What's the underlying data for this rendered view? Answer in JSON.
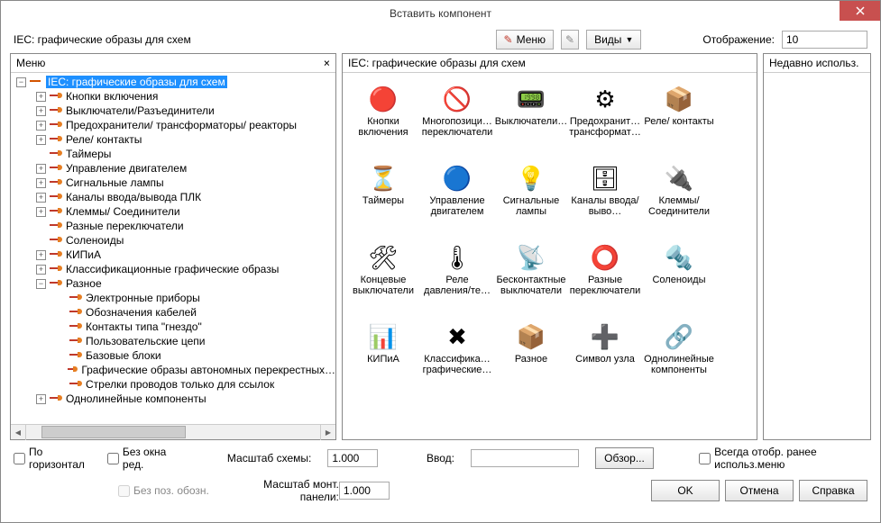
{
  "title": "Вставить компонент",
  "toprow": {
    "schema_label": "IEC: графические образы для схем",
    "menu_btn": "Меню",
    "views_btn": "Виды",
    "display_label": "Отображение:",
    "display_value": "10"
  },
  "panels": {
    "left_header": "Меню",
    "center_header": "IEC: графические образы для схем",
    "right_header": "Недавно использ."
  },
  "tree": {
    "root": "IEC: графические образы для схем",
    "level1": [
      {
        "label": "Кнопки включения",
        "exp": "+"
      },
      {
        "label": "Выключатели/Разъединители",
        "exp": "+"
      },
      {
        "label": "Предохранители/ трансформаторы/ реакторы",
        "exp": "+"
      },
      {
        "label": "Реле/ контакты",
        "exp": "+"
      },
      {
        "label": "Таймеры",
        "exp": ""
      },
      {
        "label": "Управление двигателем",
        "exp": "+"
      },
      {
        "label": "Сигнальные лампы",
        "exp": "+"
      },
      {
        "label": "Каналы ввода/вывода ПЛК",
        "exp": "+"
      },
      {
        "label": "Клеммы/ Соединители",
        "exp": "+"
      },
      {
        "label": "Разные переключатели",
        "exp": ""
      },
      {
        "label": "Соленоиды",
        "exp": ""
      },
      {
        "label": "КИПиА",
        "exp": "+"
      },
      {
        "label": "Классификационные графические образы",
        "exp": "+"
      },
      {
        "label": "Разное",
        "exp": "-",
        "children": [
          "Электронные приборы",
          "Обозначения кабелей",
          "Контакты типа \"гнездо\"",
          "Пользовательские цепи",
          "Базовые блоки",
          "Графические образы автономных перекрестных…",
          "Стрелки проводов только для ссылок"
        ]
      },
      {
        "label": "Однолинейные компоненты",
        "exp": "+"
      }
    ]
  },
  "icons": [
    {
      "label": "Кнопки включения",
      "sym": "🔴"
    },
    {
      "label": "Многопозици… переключатели",
      "sym": "🚫"
    },
    {
      "label": "Выключатели…",
      "sym": "📟"
    },
    {
      "label": "Предохранит… трансформат…",
      "sym": "⚙"
    },
    {
      "label": "Реле/ контакты",
      "sym": "📦"
    },
    {
      "label": "Таймеры",
      "sym": "⏳"
    },
    {
      "label": "Управление двигателем",
      "sym": "🔵"
    },
    {
      "label": "Сигнальные лампы",
      "sym": "💡"
    },
    {
      "label": "Каналы ввода/выво…",
      "sym": "🗄"
    },
    {
      "label": "Клеммы/ Соединители",
      "sym": "🔌"
    },
    {
      "label": "Концевые выключатели",
      "sym": "🛠"
    },
    {
      "label": "Реле давления/те…",
      "sym": "🌡"
    },
    {
      "label": "Бесконтактные выключатели",
      "sym": "📡"
    },
    {
      "label": "Разные переключатели",
      "sym": "⭕"
    },
    {
      "label": "Соленоиды",
      "sym": "🔩"
    },
    {
      "label": "КИПиА",
      "sym": "📊"
    },
    {
      "label": "Классифика… графические…",
      "sym": "✖"
    },
    {
      "label": "Разное",
      "sym": "📦"
    },
    {
      "label": "Символ узла",
      "sym": "➕"
    },
    {
      "label": "Однолинейные компоненты",
      "sym": "🔗"
    }
  ],
  "bottom": {
    "chk_horizontal": "По горизонтал",
    "chk_noeditwin": "Без окна ред.",
    "chk_nopos": "Без поз. обозн.",
    "chk_always": "Всегда отобр. ранее использ.меню",
    "scale_schema_label": "Масштаб схемы:",
    "scale_schema_value": "1.000",
    "scale_panel_label": "Масштаб монт. панели:",
    "scale_panel_value": "1.000",
    "input_label": "Ввод:",
    "input_value": "",
    "browse_btn": "Обзор...",
    "ok_btn": "OK",
    "cancel_btn": "Отмена",
    "help_btn": "Справка"
  }
}
